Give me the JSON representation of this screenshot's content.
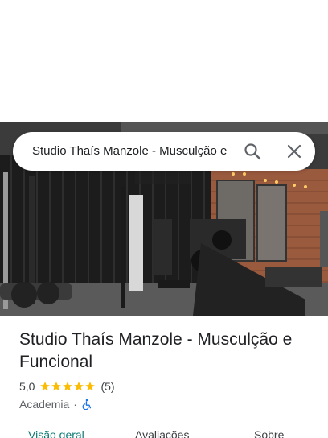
{
  "search": {
    "query": "Studio Thaís Manzole - Musculção e",
    "search_icon": "search-icon",
    "close_icon": "close-icon"
  },
  "place": {
    "title": "Studio Thaís Manzole - Musculção e Funcional",
    "rating": "5,0",
    "stars": 5,
    "review_count": "(5)",
    "category": "Academia",
    "separator": "·",
    "accessibility_icon": "wheelchair-icon"
  },
  "tabs": [
    {
      "label": "Visão geral",
      "active": true
    },
    {
      "label": "Avaliações",
      "active": false
    },
    {
      "label": "Sobre",
      "active": false
    }
  ],
  "colors": {
    "star": "#fbbc04",
    "accent": "#0b7a75",
    "accessibility": "#1a73e8"
  }
}
